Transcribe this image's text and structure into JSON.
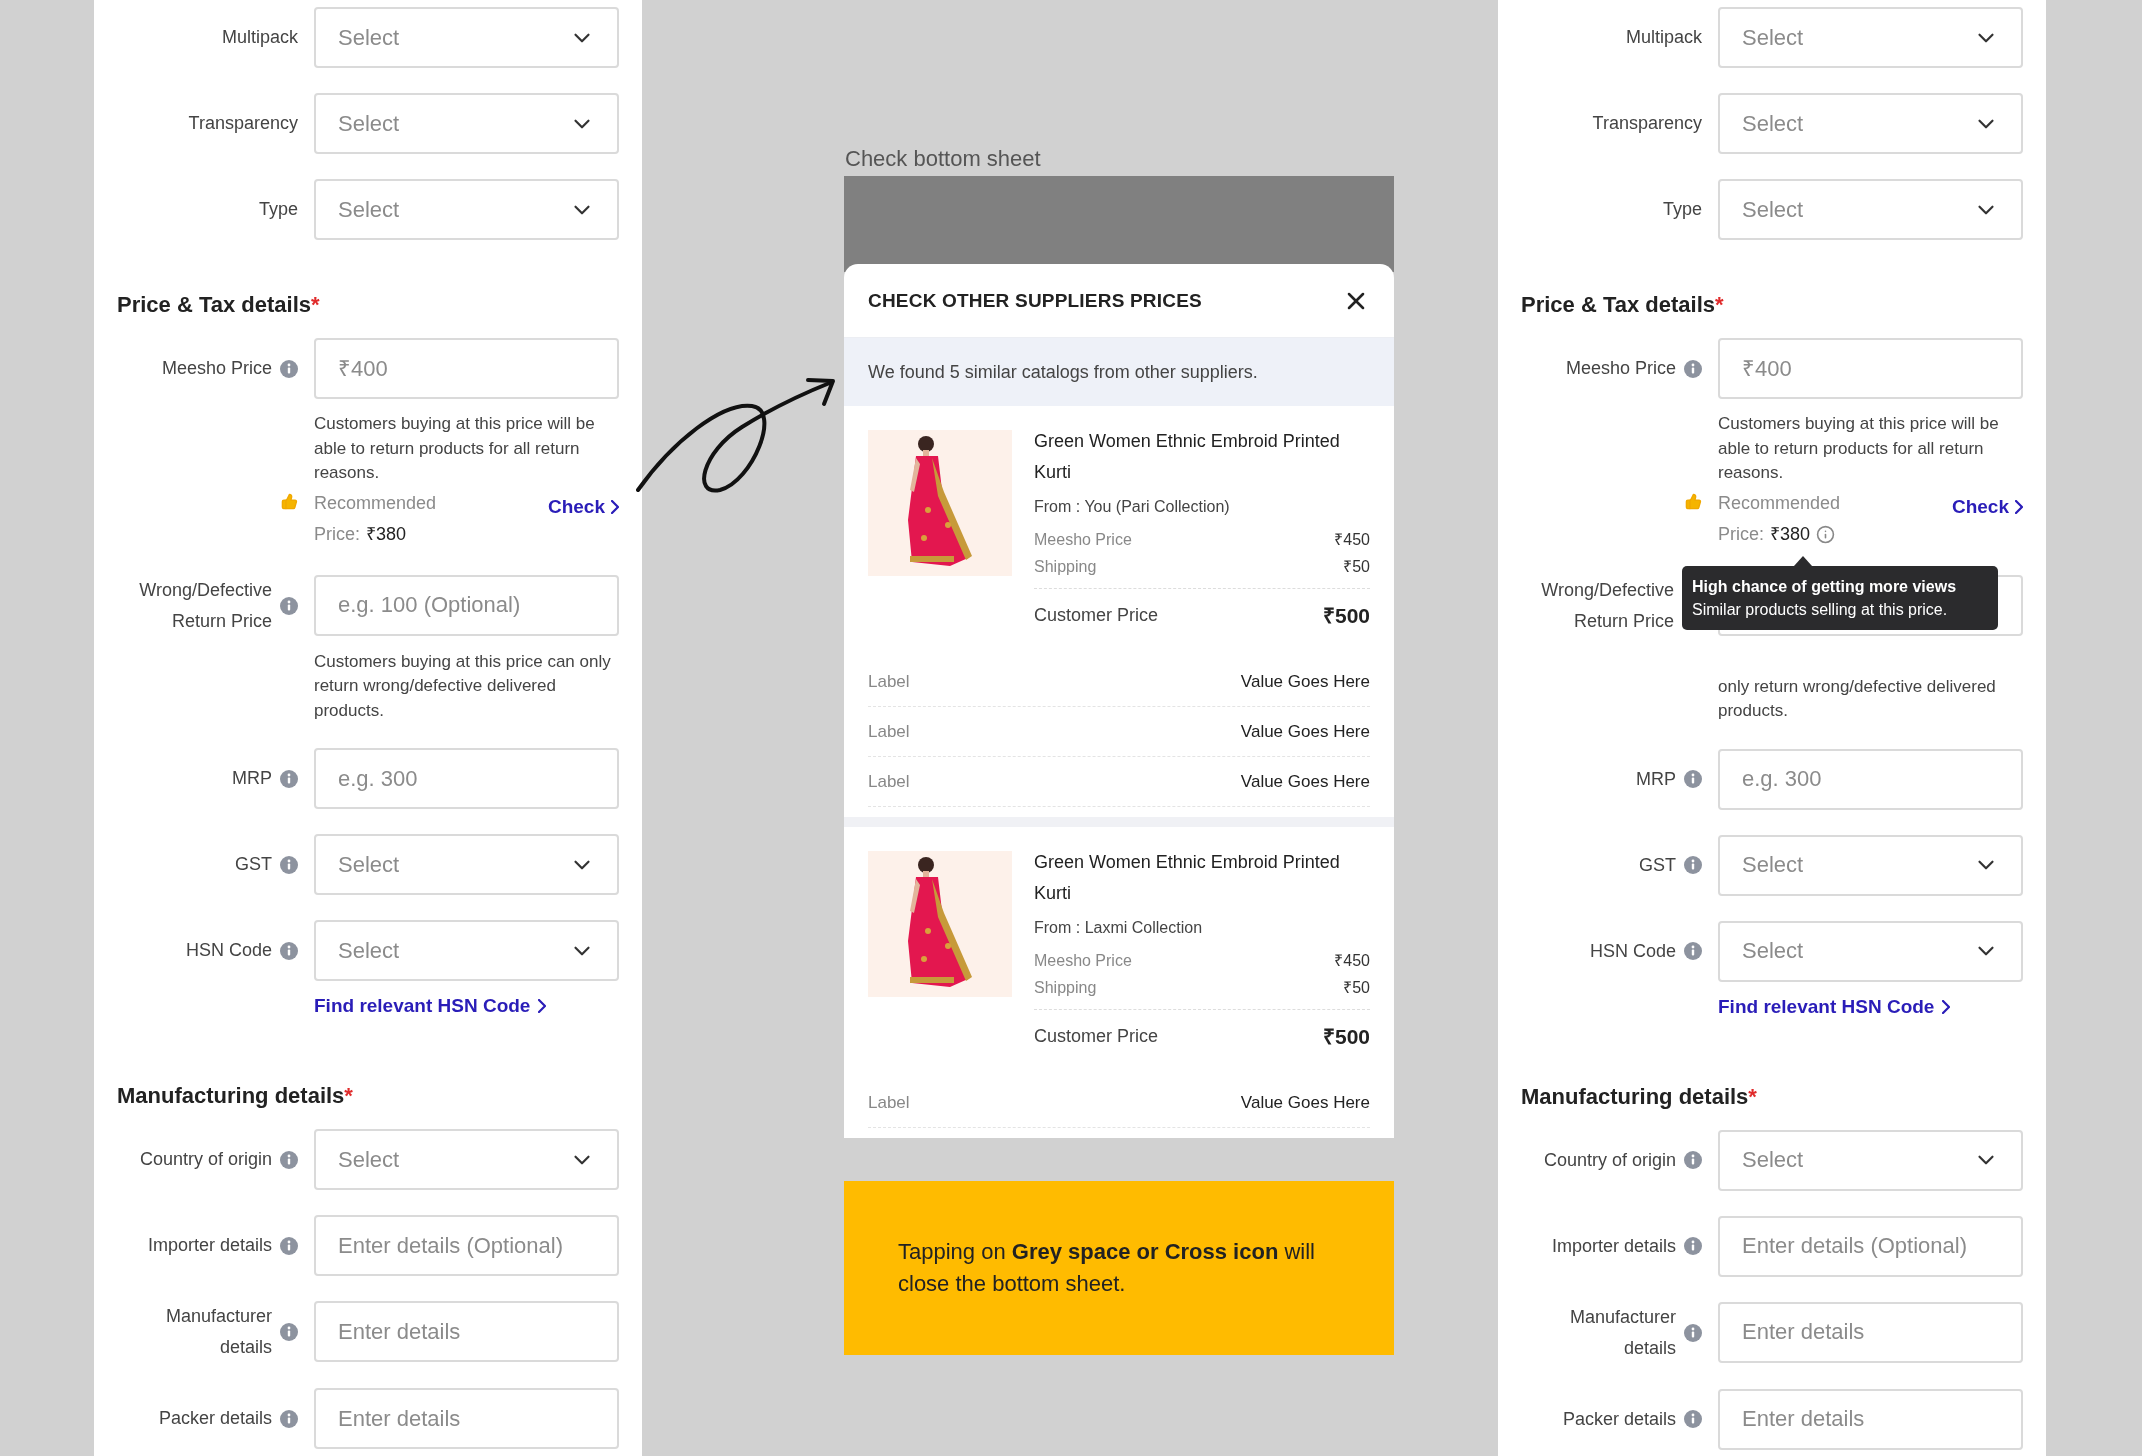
{
  "left_form": {
    "items": [
      {
        "kind": "select",
        "label": "Multipack",
        "info": false,
        "placeholder": "Select"
      },
      {
        "kind": "select",
        "label": "Transparency",
        "info": false,
        "placeholder": "Select"
      },
      {
        "kind": "select",
        "label": "Type",
        "info": false,
        "placeholder": "Select"
      },
      {
        "kind": "heading",
        "text": "Price & Tax details",
        "required_mark": "*"
      },
      {
        "kind": "text",
        "label": "Meesho Price",
        "info": true,
        "placeholder": "₹400",
        "helper": "Customers buying at this price will be able to return products for all return reasons.",
        "recommendation": {
          "label": "Recommended",
          "price_label": "Price:",
          "price": "₹380",
          "link": "Check",
          "info_icon": false
        }
      },
      {
        "kind": "text",
        "label": "Wrong/Defective Return Price",
        "info": true,
        "placeholder": "e.g. 100 (Optional)",
        "helper": "Customers buying at this price can only return wrong/defective delivered products."
      },
      {
        "kind": "text",
        "label": "MRP",
        "info": true,
        "placeholder": "e.g. 300"
      },
      {
        "kind": "select",
        "label": "GST",
        "info": true,
        "placeholder": "Select"
      },
      {
        "kind": "select",
        "label": "HSN Code",
        "info": true,
        "placeholder": "Select",
        "link": "Find relevant HSN Code"
      },
      {
        "kind": "heading",
        "text": "Manufacturing details",
        "required_mark": "*"
      },
      {
        "kind": "select",
        "label": "Country of origin",
        "info": true,
        "placeholder": "Select"
      },
      {
        "kind": "text",
        "label": "Importer details",
        "info": true,
        "placeholder": "Enter details (Optional)"
      },
      {
        "kind": "text",
        "label": "Manufacturer details",
        "info": true,
        "placeholder": "Enter details"
      },
      {
        "kind": "text",
        "label": "Packer details",
        "info": true,
        "placeholder": "Enter details"
      }
    ]
  },
  "bottom_sheet": {
    "caption": "Check bottom sheet",
    "title": "CHECK OTHER SUPPLIERS PRICES",
    "banner": "We found 5 similar catalogs from other suppliers.",
    "products": [
      {
        "name": "Green Women Ethnic Embroid Printed Kurti",
        "from": "From : You (Pari Collection)",
        "meesho_price_label": "Meesho Price",
        "meesho_price": "₹450",
        "shipping_label": "Shipping",
        "shipping": "₹50",
        "customer_price_label": "Customer Price",
        "customer_price": "₹500",
        "details": [
          {
            "label": "Label",
            "value": "Value Goes Here"
          },
          {
            "label": "Label",
            "value": "Value Goes Here"
          },
          {
            "label": "Label",
            "value": "Value Goes Here"
          }
        ]
      },
      {
        "name": "Green Women Ethnic Embroid Printed Kurti",
        "from": "From : Laxmi Collection",
        "meesho_price_label": "Meesho Price",
        "meesho_price": "₹450",
        "shipping_label": "Shipping",
        "shipping": "₹50",
        "customer_price_label": "Customer Price",
        "customer_price": "₹500",
        "details": [
          {
            "label": "Label",
            "value": "Value Goes Here"
          }
        ]
      }
    ],
    "note": "Tapping on **Grey space or Cross icon** will close the bottom sheet."
  },
  "right_form": {
    "items": [
      {
        "kind": "select",
        "label": "Multipack",
        "info": false,
        "placeholder": "Select"
      },
      {
        "kind": "select",
        "label": "Transparency",
        "info": false,
        "placeholder": "Select"
      },
      {
        "kind": "select",
        "label": "Type",
        "info": false,
        "placeholder": "Select"
      },
      {
        "kind": "heading",
        "text": "Price & Tax details",
        "required_mark": "*"
      },
      {
        "kind": "text",
        "label": "Meesho Price",
        "info": true,
        "placeholder": "₹400",
        "helper": "Customers buying at this price will be able to return products for all return reasons.",
        "recommendation": {
          "label": "Recommended",
          "price_label": "Price:",
          "price": "₹380",
          "link": "Check",
          "info_icon": true,
          "tooltip": {
            "title": "High chance of getting more views",
            "text": "Similar products selling at this price."
          }
        }
      },
      {
        "kind": "text",
        "label": "Wrong/Defective Return Price",
        "info": false,
        "helper": "only return wrong/defective delivered products."
      },
      {
        "kind": "text",
        "label": "MRP",
        "info": true,
        "placeholder": "e.g. 300"
      },
      {
        "kind": "select",
        "label": "GST",
        "info": true,
        "placeholder": "Select"
      },
      {
        "kind": "select",
        "label": "HSN Code",
        "info": true,
        "placeholder": "Select",
        "link": "Find relevant HSN Code"
      },
      {
        "kind": "heading",
        "text": "Manufacturing details",
        "required_mark": "*"
      },
      {
        "kind": "select",
        "label": "Country of origin",
        "info": true,
        "placeholder": "Select"
      },
      {
        "kind": "text",
        "label": "Importer details",
        "info": true,
        "placeholder": "Enter details (Optional)"
      },
      {
        "kind": "text",
        "label": "Manufacturer details",
        "info": true,
        "placeholder": "Enter details"
      },
      {
        "kind": "text",
        "label": "Packer details",
        "info": true,
        "placeholder": "Enter details"
      }
    ]
  }
}
